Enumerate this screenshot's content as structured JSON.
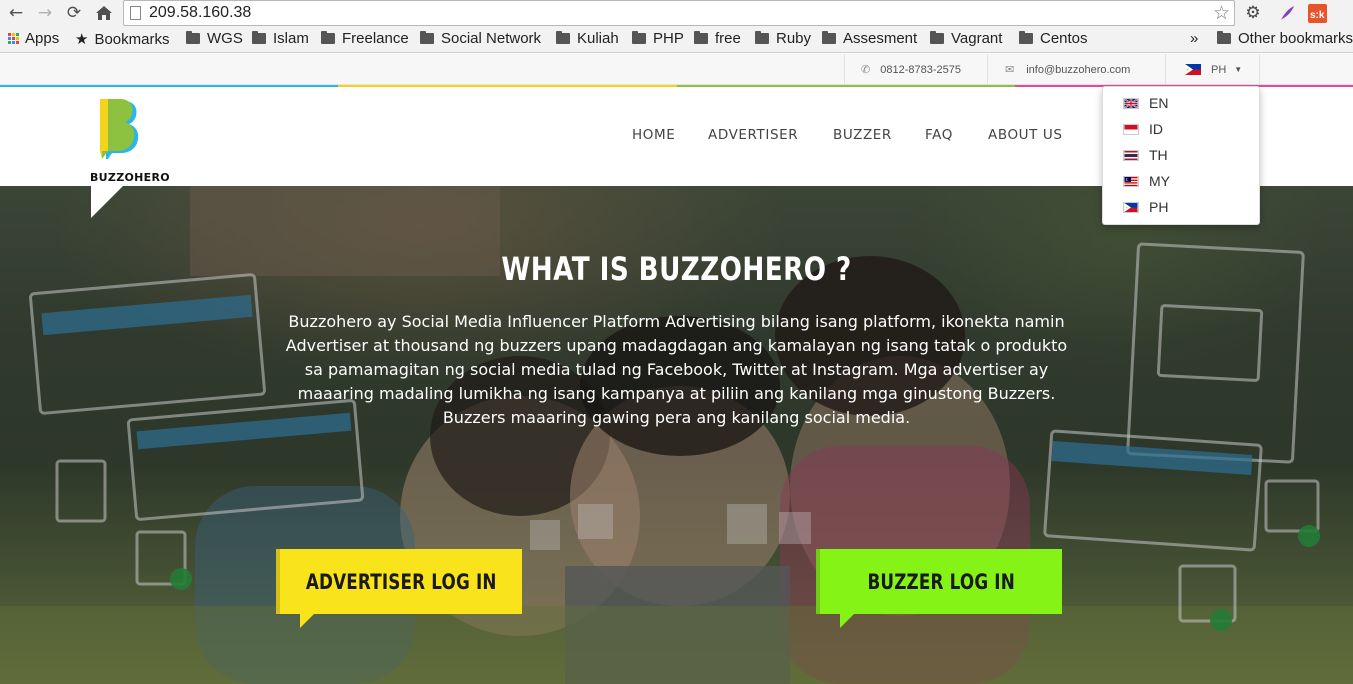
{
  "browser": {
    "url": "209.58.160.38",
    "bookmarks_label": "Bookmarks",
    "apps_label": "Apps",
    "folders": [
      "WGS",
      "Islam",
      "Freelance",
      "Social Network",
      "Kuliah",
      "PHP",
      "free",
      "Ruby",
      "Assesment",
      "Vagrant",
      "Centos"
    ],
    "overflow_chevron": "»",
    "other_bookmarks": "Other bookmarks"
  },
  "topbar": {
    "phone": "0812-8783-2575",
    "email": "info@buzzohero.com",
    "language_selected": "PH"
  },
  "language_menu": {
    "items": [
      "EN",
      "ID",
      "TH",
      "MY",
      "PH"
    ]
  },
  "header": {
    "logo_text": "BUZZOHERO",
    "menu": [
      "HOME",
      "ADVERTISER",
      "BUZZER",
      "FAQ",
      "ABOUT US"
    ]
  },
  "hero": {
    "title": "WHAT IS BUZZOHERO ?",
    "description": "Buzzohero ay Social Media Influencer Platform Advertising bilang isang platform, ikonekta namin Advertiser at thousand ng buzzers upang madagdagan ang kamalayan ng isang tatak o produkto sa pamamagitan ng social media tulad ng Facebook, Twitter at Instagram. Mga advertiser ay maaaring madaling lumikha ng isang kampanya at piliin ang kanilang mga ginustong Buzzers. Buzzers maaaring gawing pera ang kanilang social media.",
    "advertiser_login": "ADVERTISER LOG IN",
    "buzzer_login": "BUZZER LOG IN"
  },
  "colors": {
    "advertiser_button": "#f9e31a",
    "buzzer_button": "#86f316",
    "logo_yellow": "#f4d31c",
    "logo_green": "#8cc23f",
    "logo_blue": "#2bb6e4"
  }
}
